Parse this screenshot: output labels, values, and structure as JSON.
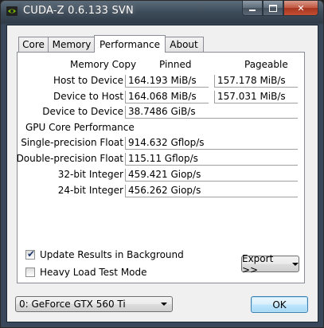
{
  "window": {
    "title": "CUDA-Z 0.6.133 SVN",
    "controls": [
      "minimize",
      "maximize",
      "close"
    ]
  },
  "tabs": [
    {
      "label": "Core",
      "active": false
    },
    {
      "label": "Memory",
      "active": false
    },
    {
      "label": "Performance",
      "active": true
    },
    {
      "label": "About",
      "active": false
    }
  ],
  "performance": {
    "memory_copy": {
      "heading": "Memory Copy",
      "col_pinned": "Pinned",
      "col_pageable": "Pageable",
      "rows": [
        {
          "label": "Host to Device",
          "pinned": "164.193 MiB/s",
          "pageable": "157.178 MiB/s"
        },
        {
          "label": "Device to Host",
          "pinned": "164.068 MiB/s",
          "pageable": "157.031 MiB/s"
        },
        {
          "label": "Device to Device",
          "pinned": "38.7486 GiB/s",
          "pageable": ""
        }
      ]
    },
    "gpu_core": {
      "heading": "GPU Core Performance",
      "rows": [
        {
          "label": "Single-precision Float",
          "value": "914.632 Gflop/s"
        },
        {
          "label": "Double-precision Float",
          "value": "115.11 Gflop/s"
        },
        {
          "label": "32-bit Integer",
          "value": "459.421 Giop/s"
        },
        {
          "label": "24-bit Integer",
          "value": "456.262 Giop/s"
        }
      ]
    },
    "update_results": {
      "label": "Update Results in Background",
      "checked": true
    },
    "heavy_load": {
      "label": "Heavy Load Test Mode",
      "checked": false
    },
    "export_button": "Export >>"
  },
  "device_select": {
    "selected": "0: GeForce GTX 560 Ti"
  },
  "ok_button": "OK",
  "colors": {
    "titlebar": "#3e4c5a",
    "client_bg": "#f0f0f0",
    "panel_bg": "#ffffff",
    "ok_border": "#3c7fb1"
  }
}
